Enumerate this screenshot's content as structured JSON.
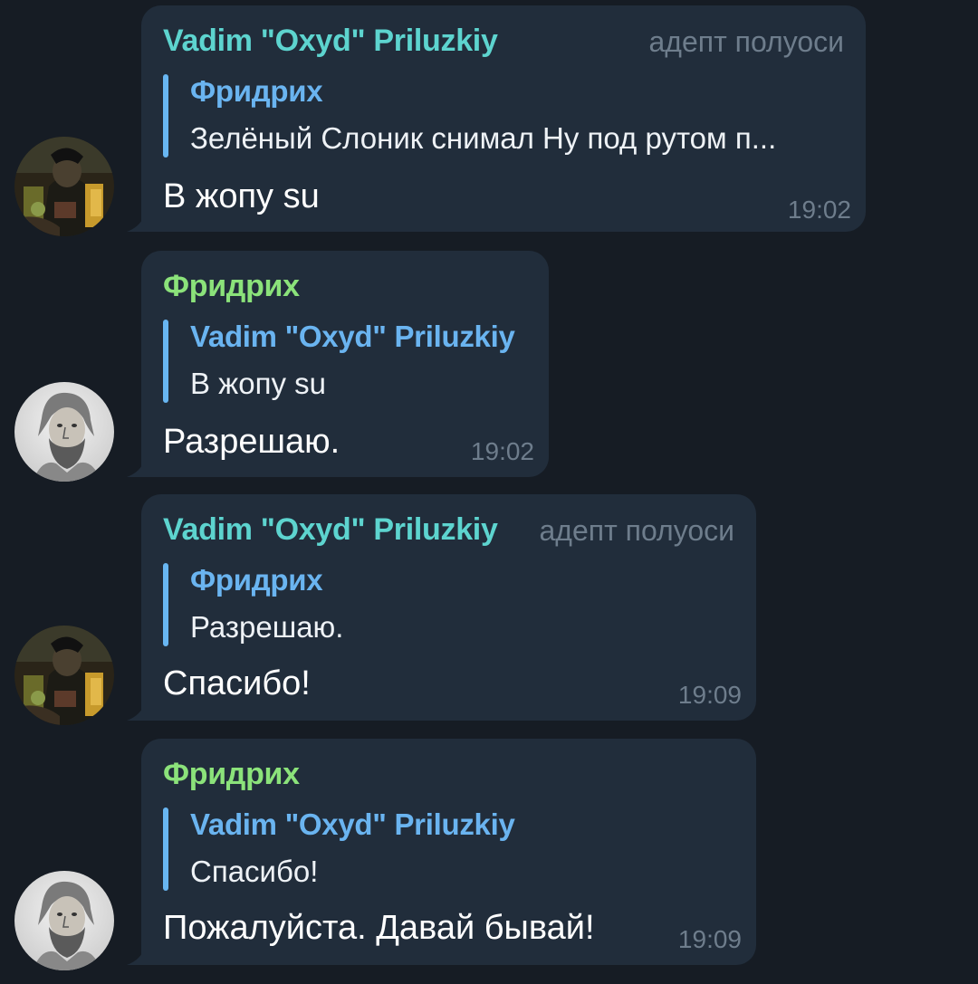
{
  "colors": {
    "background": "#161c24",
    "bubble": "#212d3b",
    "sender_teal": "#5dd4cf",
    "sender_green": "#8be27a",
    "reply_accent": "#68b6f2",
    "muted": "#6e7d8c"
  },
  "messages": [
    {
      "avatar_icon": "avatar-dark-figure",
      "sender": "Vadim \"Oxyd\" Priluzkiy",
      "badge": "адепт полуоси",
      "reply_to": {
        "name": "Фридрих",
        "text": "Зелёный Слоник снимал Ну под рутом п..."
      },
      "text": "В жопу su",
      "time": "19:02"
    },
    {
      "avatar_icon": "avatar-bearded-portrait",
      "sender": "Фридрих",
      "reply_to": {
        "name": "Vadim \"Oxyd\" Priluzkiy",
        "text": "В жопу su"
      },
      "text": "Разрешаю.",
      "time": "19:02"
    },
    {
      "avatar_icon": "avatar-dark-figure",
      "sender": "Vadim \"Oxyd\" Priluzkiy",
      "badge": "адепт полуоси",
      "reply_to": {
        "name": "Фридрих",
        "text": "Разрешаю."
      },
      "text": "Спасибо!",
      "time": "19:09"
    },
    {
      "avatar_icon": "avatar-bearded-portrait",
      "sender": "Фридрих",
      "reply_to": {
        "name": "Vadim \"Oxyd\" Priluzkiy",
        "text": "Спасибо!"
      },
      "text": "Пожалуйста. Давай бывай!",
      "time": "19:09"
    }
  ]
}
